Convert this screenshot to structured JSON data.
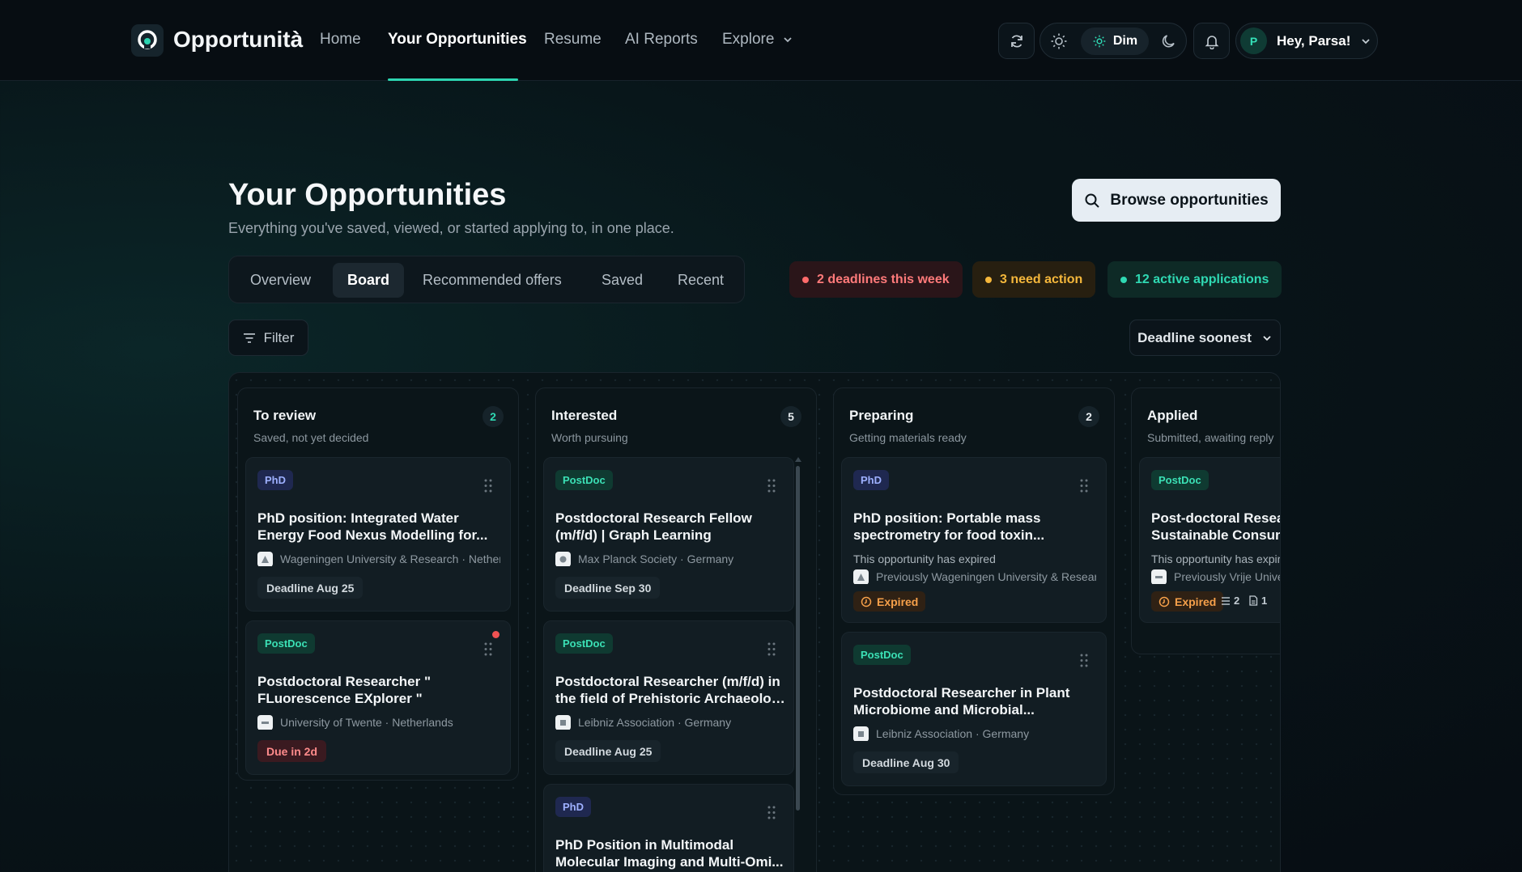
{
  "app": {
    "name": "Opportunità"
  },
  "nav": {
    "links": [
      "Home",
      "Your Opportunities",
      "Resume",
      "AI Reports",
      "Explore"
    ],
    "active": "Your Opportunities",
    "theme_active": "Dim",
    "greeting": "Hey, Parsa!",
    "avatar_initial": "P"
  },
  "header": {
    "title": "Your Opportunities",
    "subtitle": "Everything you've saved, viewed, or started applying to, in one place.",
    "browse_label": "Browse opportunities"
  },
  "tabs": [
    "Overview",
    "Board",
    "Recommended offers",
    "Saved",
    "Recent"
  ],
  "active_tab": "Board",
  "stats": [
    {
      "label": "2 deadlines this week",
      "color": "#ff7a7a"
    },
    {
      "label": "3 need action",
      "color": "#f5b73b"
    },
    {
      "label": "12 active applications",
      "color": "#2fd9b3"
    }
  ],
  "filter_label": "Filter",
  "sort_label": "Deadline soonest",
  "columns": [
    {
      "title": "To review",
      "subtitle": "Saved, not yet decided",
      "count": "2",
      "cards": [
        {
          "tag": "PhD",
          "title1": "PhD position: Integrated Water",
          "title2": "Energy Food Nexus Modelling for...",
          "org": "Wageningen University & Research · Netherlands",
          "deadline": "Deadline Aug 25"
        },
        {
          "tag": "PostDoc",
          "title1": "Postdoctoral Researcher \"",
          "title2": "FLuorescence EXplorer \"",
          "org": "University of Twente · Netherlands",
          "due": "Due in 2d"
        }
      ]
    },
    {
      "title": "Interested",
      "subtitle": "Worth pursuing",
      "count": "5",
      "cards": [
        {
          "tag": "PostDoc",
          "title1": "Postdoctoral Research Fellow",
          "title2": "(m/f/d) | Graph Learning",
          "org": "Max Planck Society · Germany",
          "deadline": "Deadline Sep 30"
        },
        {
          "tag": "PostDoc",
          "title1": "Postdoctoral Researcher (m/f/d) in",
          "title2": "the field of Prehistoric Archaeology",
          "org": "Leibniz Association · Germany",
          "deadline": "Deadline Aug 25"
        },
        {
          "tag": "PhD",
          "title1": "PhD Position in Multimodal",
          "title2": "Molecular Imaging and Multi-Omi..."
        }
      ]
    },
    {
      "title": "Preparing",
      "subtitle": "Getting materials ready",
      "count": "2",
      "cards": [
        {
          "tag": "PhD",
          "title1": "PhD position: Portable mass",
          "title2": "spectrometry for food toxin...",
          "note": "This opportunity has expired",
          "org": "Previously Wageningen University & Research",
          "expired": "Expired"
        },
        {
          "tag": "PostDoc",
          "title1": "Postdoctoral Researcher in Plant",
          "title2": "Microbiome and Microbial...",
          "org": "Leibniz Association · Germany",
          "deadline": "Deadline Aug 30"
        }
      ]
    },
    {
      "title": "Applied",
      "subtitle": "Submitted, awaiting reply",
      "cards": [
        {
          "tag": "PostDoc",
          "title1": "Post-doctoral Researcher",
          "title2": "Sustainable Consumer",
          "note": "This opportunity has expired",
          "org": "Previously Vrije Universiteit",
          "expired": "Expired",
          "checklist": "2",
          "docs": "1"
        }
      ]
    }
  ]
}
